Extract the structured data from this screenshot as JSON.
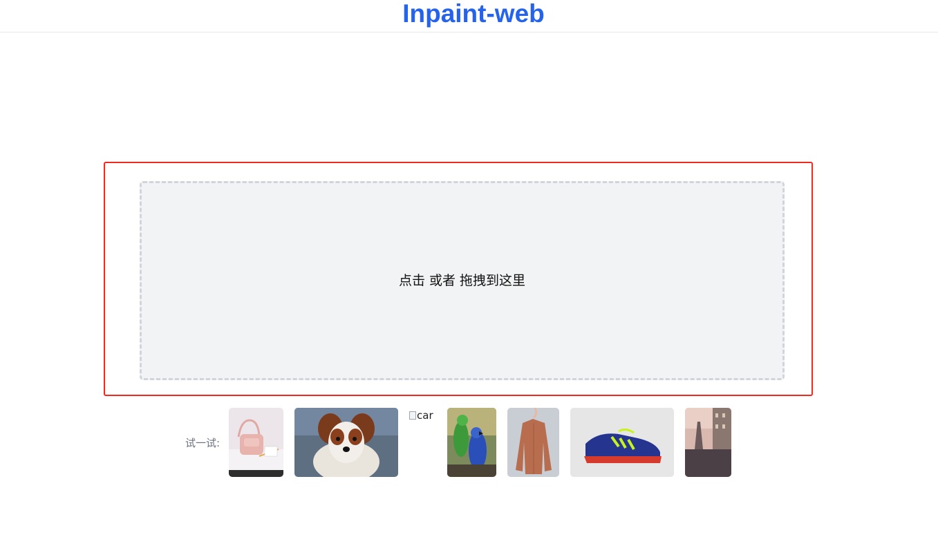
{
  "header": {
    "title": "Inpaint-web"
  },
  "upload": {
    "prompt": "点击 或者 拖拽到这里"
  },
  "examples": {
    "label": "试一试:",
    "broken_image_alt": "car",
    "items": [
      "bag-thumbnail",
      "dog-thumbnail",
      "car-thumbnail-broken",
      "parrots-thumbnail",
      "jacket-thumbnail",
      "sneaker-thumbnail",
      "paris-thumbnail"
    ]
  },
  "colors": {
    "accent": "#2563eb",
    "frame_border": "#ef2a1f",
    "dropzone_bg": "#f2f3f5",
    "dropzone_border": "#d1d5db"
  }
}
